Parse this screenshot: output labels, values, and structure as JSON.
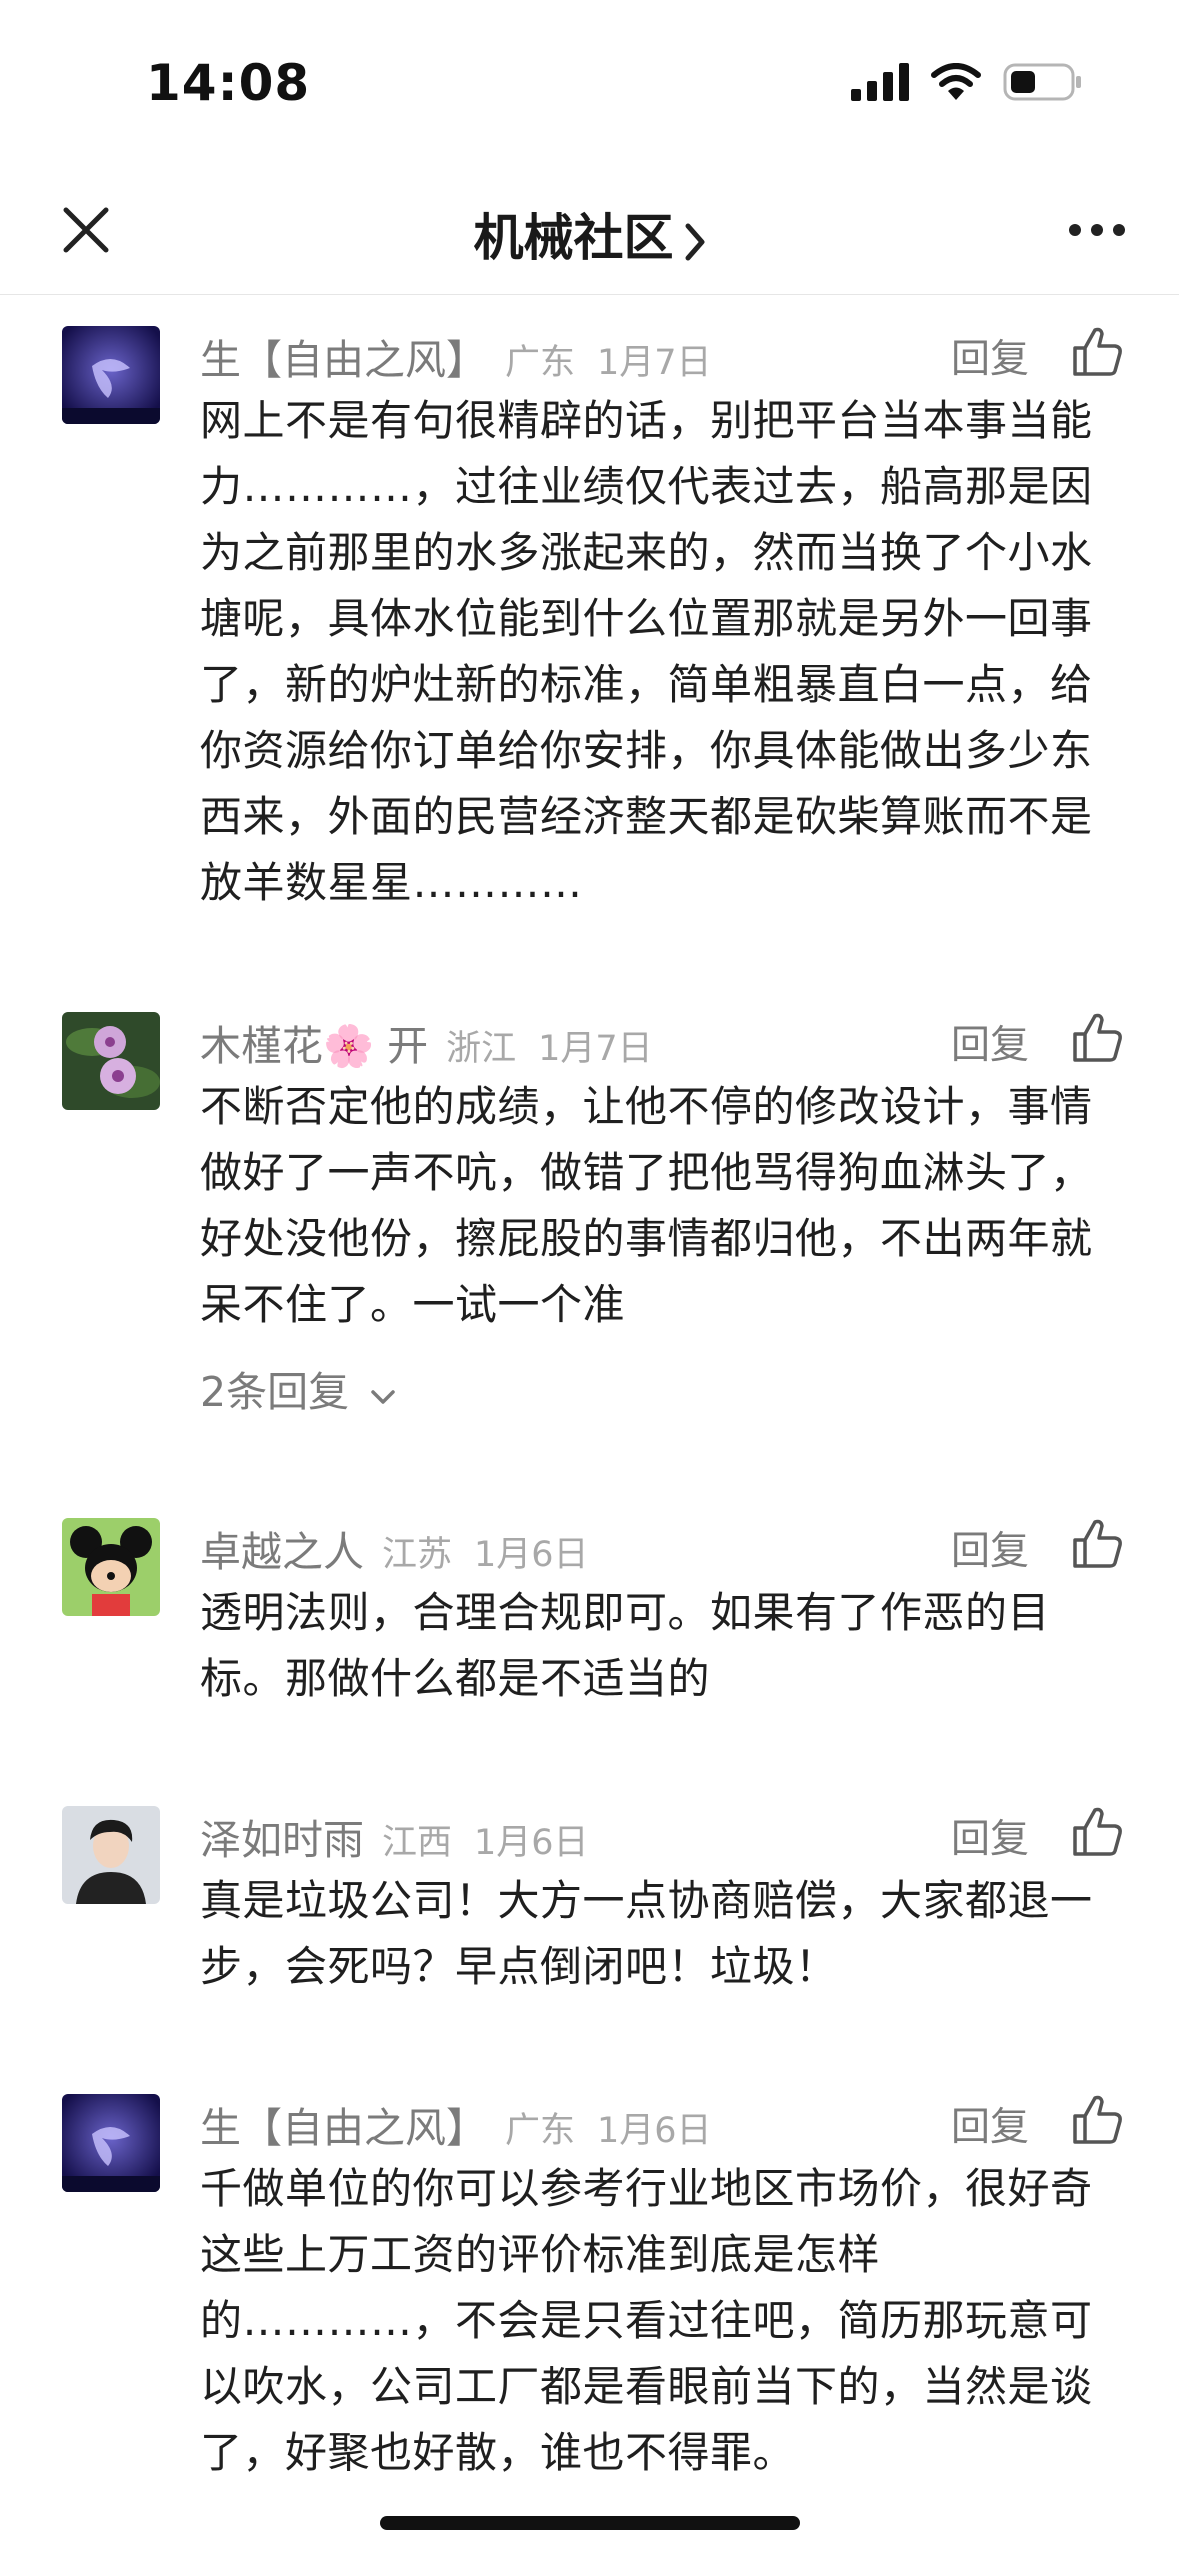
{
  "status": {
    "time": "14:08"
  },
  "nav": {
    "title": "机械社区",
    "title_chevron_icon": "chevron-right-icon",
    "close_icon": "close-icon",
    "more_icon": "more-icon"
  },
  "comments": [
    {
      "name": "生【自由之风】",
      "location": "广东",
      "date": "1月7日",
      "reply_label": "回复",
      "text": "网上不是有句很精辟的话，别把平台当本事当能力…………，过往业绩仅代表过去，船高那是因为之前那里的水多涨起来的，然而当换了个小水塘呢，具体水位能到什么位置那就是另外一回事了，新的炉灶新的标准，简单粗暴直白一点，给你资源给你订单给你安排，你具体能做出多少东西来，外面的民营经济整天都是砍柴算账而不是放羊数星星…………"
    },
    {
      "name": "木槿花🌸 开",
      "location": "浙江",
      "date": "1月7日",
      "reply_label": "回复",
      "text": "不断否定他的成绩，让他不停的修改设计，事情做好了一声不吭，做错了把他骂得狗血淋头了，好处没他份，擦屁股的事情都归他，不出两年就呆不住了。一试一个准",
      "sub_replies": "2条回复"
    },
    {
      "name": "卓越之人",
      "location": "江苏",
      "date": "1月6日",
      "reply_label": "回复",
      "text": "透明法则，合理合规即可。如果有了作恶的目标。那做什么都是不适当的"
    },
    {
      "name": "泽如时雨",
      "location": "江西",
      "date": "1月6日",
      "reply_label": "回复",
      "text": "真是垃圾公司！大方一点协商赔偿，大家都退一步，会死吗？早点倒闭吧！垃圾！"
    },
    {
      "name": "生【自由之风】",
      "location": "广东",
      "date": "1月6日",
      "reply_label": "回复",
      "text": "千做单位的你可以参考行业地区市场价，很好奇这些上万工资的评价标准到底是怎样的…………，不会是只看过往吧，简历那玩意可以吹水，公司工厂都是看眼前当下的，当然是谈了，好聚也好散，谁也不得罪。"
    }
  ]
}
